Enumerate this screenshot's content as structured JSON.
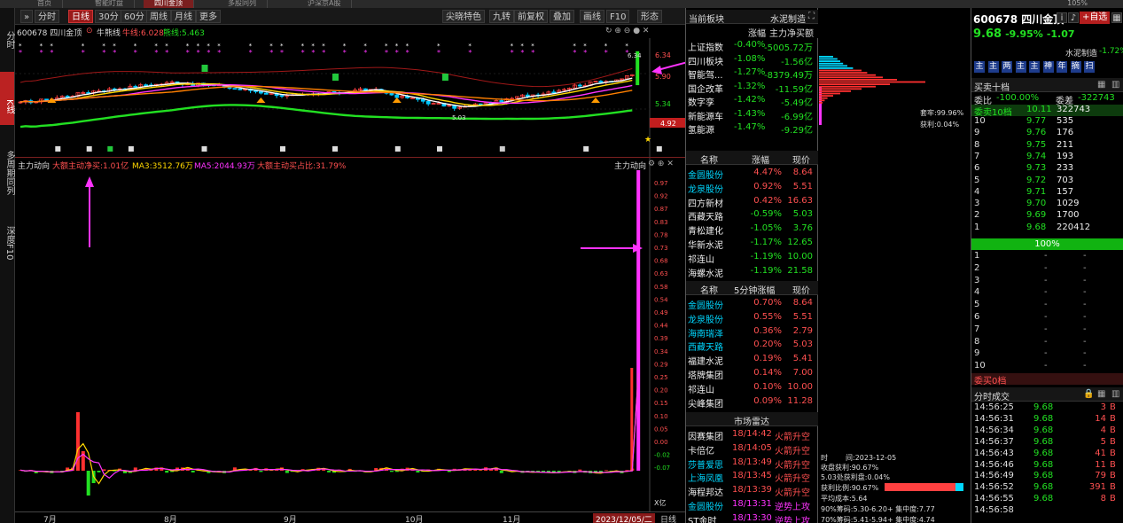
{
  "topbar": {
    "tabs": [
      "首页",
      "智能盯盘",
      "四川金顶",
      "多股同列",
      "沪深京A股"
    ],
    "active_tab": 2,
    "zoom": "105%"
  },
  "leftnav": [
    "分时",
    "K线",
    "多周期同列",
    "深度F10"
  ],
  "toolbar": {
    "buttons": [
      "分时",
      "日线",
      "30分",
      "60分",
      "周线",
      "月线",
      "更多"
    ],
    "right_buttons": [
      "尖晓特色",
      "九转",
      "前复权",
      "叠加",
      "画线",
      "F10",
      "形态"
    ]
  },
  "chart_info": {
    "stock": "600678 四川金顶",
    "indicator": "牛熊线",
    "bull": "牛线:6.028",
    "bear": "熊线:5.463"
  },
  "price_axis": [
    "6.34",
    "5.90",
    "5.34",
    "4.92"
  ],
  "price_labels": {
    "top": "6.34",
    "low": "5.03",
    "current": "4.92"
  },
  "sub_chart": {
    "title": "主力动向",
    "net": "大额主动净买:1.01亿",
    "ma3": "MA3:3512.76万",
    "ma5": "MA5:2044.93万",
    "ratio": "大额主动买占比:31.79%",
    "title_right": "主力动向",
    "axis": [
      "0.97",
      "0.92",
      "0.87",
      "0.83",
      "0.78",
      "0.73",
      "0.68",
      "0.63",
      "0.58",
      "0.54",
      "0.49",
      "0.44",
      "0.39",
      "0.34",
      "0.29",
      "0.25",
      "0.20",
      "0.15",
      "0.10",
      "0.05",
      "0.00",
      "-0.02",
      "-0.07"
    ],
    "unit": "X亿"
  },
  "xaxis": {
    "months": [
      "7月",
      "8月",
      "9月",
      "10月",
      "11月"
    ],
    "date": "2023/12/05/二",
    "period": "日线"
  },
  "sector_panel": {
    "header": [
      "当前板块",
      "水泥制造"
    ],
    "col_headers": [
      "",
      "涨幅",
      "主力净买额"
    ],
    "rows": [
      {
        "name": "上证指数",
        "chg": "-0.40%",
        "amt": "-5005.72万"
      },
      {
        "name": "四川板块",
        "chg": "-1.08%",
        "amt": "-1.56亿"
      },
      {
        "name": "智能驾...",
        "chg": "-1.27%",
        "amt": "-8379.49万"
      },
      {
        "name": "国企改革",
        "chg": "-1.32%",
        "amt": "-11.59亿"
      },
      {
        "name": "数字孪",
        "chg": "-1.42%",
        "amt": "-5.49亿"
      },
      {
        "name": "新能源车",
        "chg": "-1.43%",
        "amt": "-6.99亿"
      },
      {
        "name": "氢能源",
        "chg": "-1.47%",
        "amt": "-9.29亿"
      }
    ]
  },
  "peer_panel": {
    "col_headers": [
      "名称",
      "涨幅",
      "现价"
    ],
    "rows": [
      {
        "name": "金圆股份",
        "chg": "4.47%",
        "price": "8.64"
      },
      {
        "name": "龙泉股份",
        "chg": "0.92%",
        "price": "5.51"
      },
      {
        "name": "四方新材",
        "chg": "0.42%",
        "price": "16.63"
      },
      {
        "name": "西藏天路",
        "chg": "-0.59%",
        "price": "5.03"
      },
      {
        "name": "青松建化",
        "chg": "-1.05%",
        "price": "3.76"
      },
      {
        "name": "华新水泥",
        "chg": "-1.17%",
        "price": "12.65"
      },
      {
        "name": "祁连山",
        "chg": "-1.19%",
        "price": "10.00"
      },
      {
        "name": "海螺水泥",
        "chg": "-1.19%",
        "price": "21.58"
      }
    ]
  },
  "speed_panel": {
    "col_headers": [
      "名称",
      "5分钟涨幅",
      "现价"
    ],
    "rows": [
      {
        "name": "金圆股份",
        "chg": "0.70%",
        "price": "8.64"
      },
      {
        "name": "龙泉股份",
        "chg": "0.55%",
        "price": "5.51"
      },
      {
        "name": "海南瑞泽",
        "chg": "0.36%",
        "price": "2.79"
      },
      {
        "name": "西藏天路",
        "chg": "0.20%",
        "price": "5.03"
      },
      {
        "name": "福建水泥",
        "chg": "0.19%",
        "price": "5.41"
      },
      {
        "name": "塔牌集团",
        "chg": "0.14%",
        "price": "7.00"
      },
      {
        "name": "祁连山",
        "chg": "0.10%",
        "price": "10.00"
      },
      {
        "name": "尖峰集团",
        "chg": "0.09%",
        "price": "11.28"
      }
    ]
  },
  "radar_panel": {
    "title": "市场雷达",
    "rows": [
      {
        "name": "因赛集团",
        "time": "18/14:42",
        "event": "火箭升空"
      },
      {
        "name": "卡倍亿",
        "time": "18/14:05",
        "event": "火箭升空"
      },
      {
        "name": "莎普爱思",
        "time": "18/13:49",
        "event": "火箭升空"
      },
      {
        "name": "上海凤凰",
        "time": "18/13:45",
        "event": "火箭升空"
      },
      {
        "name": "海程邦达",
        "time": "18/13:39",
        "event": "火箭升空"
      },
      {
        "name": "金圆股份",
        "time": "18/13:31",
        "event": "逆势上攻"
      },
      {
        "name": "ST金时",
        "time": "18/13:30",
        "event": "逆势上攻"
      }
    ]
  },
  "dist_panel": {
    "profit_ratio": "套牢:99.96%",
    "gain": "获利:0.04%",
    "time_label": "时",
    "date": "间:2023-12-05",
    "lines": [
      "收盘获利:90.67%",
      "5.03处获利盘:0.04%",
      "获利比例:90.67%",
      "平均成本:5.64",
      "90%筹码:5.30-6.20+ 集中度:7.77",
      "70%筹码:5.41-5.94+ 集中度:4.74"
    ]
  },
  "quote": {
    "title": "600678 四川金顶",
    "add_label": "+自选",
    "price": "9.68",
    "chg_pct": "-9.95%",
    "chg": "-1.07",
    "sector": "水泥制造",
    "sector_chg": "-1.72%",
    "tags": [
      "主",
      "主",
      "两",
      "主",
      "主",
      "神",
      "年",
      "摘",
      "扫"
    ],
    "orderbook_title": "买卖十档",
    "weibi_label": "委比",
    "weibi": "-100.00%",
    "weicha_label": "委差",
    "weicha": "-322743",
    "sell10_label": "委卖10档",
    "sell10_price": "10.11",
    "sell10_vol": "322743",
    "asks": [
      {
        "lvl": "10",
        "price": "9.77",
        "vol": "535"
      },
      {
        "lvl": "9",
        "price": "9.76",
        "vol": "176"
      },
      {
        "lvl": "8",
        "price": "9.75",
        "vol": "211"
      },
      {
        "lvl": "7",
        "price": "9.74",
        "vol": "193"
      },
      {
        "lvl": "6",
        "price": "9.73",
        "vol": "233"
      },
      {
        "lvl": "5",
        "price": "9.72",
        "vol": "703"
      },
      {
        "lvl": "4",
        "price": "9.71",
        "vol": "157"
      },
      {
        "lvl": "3",
        "price": "9.70",
        "vol": "1029"
      },
      {
        "lvl": "2",
        "price": "9.69",
        "vol": "1700"
      },
      {
        "lvl": "1",
        "price": "9.68",
        "vol": "220412"
      }
    ],
    "pct_bar": "100%",
    "bids": [
      "1",
      "2",
      "3",
      "4",
      "5",
      "6",
      "7",
      "8",
      "9",
      "10"
    ],
    "dash": "-",
    "buy0_label": "委买0档",
    "trades_title": "分时成交",
    "trades": [
      {
        "t": "14:56:25",
        "p": "9.68",
        "v": "3",
        "s": "B"
      },
      {
        "t": "14:56:31",
        "p": "9.68",
        "v": "14",
        "s": "B"
      },
      {
        "t": "14:56:34",
        "p": "9.68",
        "v": "4",
        "s": "B"
      },
      {
        "t": "14:56:37",
        "p": "9.68",
        "v": "5",
        "s": "B"
      },
      {
        "t": "14:56:43",
        "p": "9.68",
        "v": "41",
        "s": "B"
      },
      {
        "t": "14:56:46",
        "p": "9.68",
        "v": "11",
        "s": "B"
      },
      {
        "t": "14:56:49",
        "p": "9.68",
        "v": "79",
        "s": "B"
      },
      {
        "t": "14:56:52",
        "p": "9.68",
        "v": "391",
        "s": "B"
      },
      {
        "t": "14:56:55",
        "p": "9.68",
        "v": "8",
        "s": "B"
      },
      {
        "t": "14:56:58",
        "p": "",
        "v": "",
        "s": ""
      }
    ]
  },
  "colors": {
    "up": "#ff5050",
    "down": "#22e022",
    "accent": "#ff33ff",
    "cyan": "#00d7ff"
  }
}
